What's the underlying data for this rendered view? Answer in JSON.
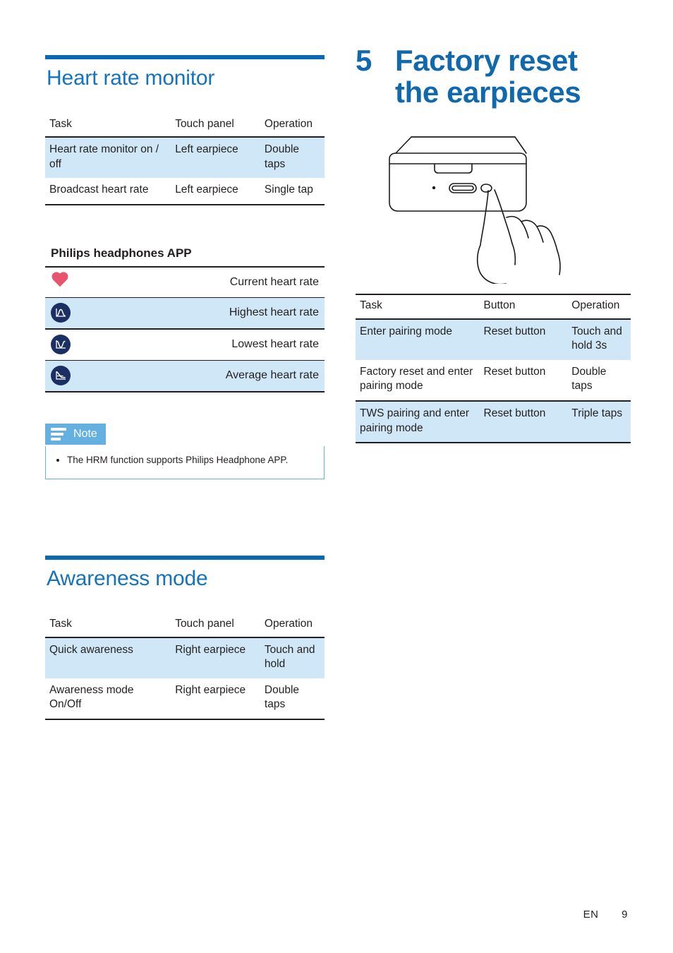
{
  "page": {
    "footer_lang": "EN",
    "footer_page": "9",
    "accent_blue": "#0b68b4",
    "heading_blue": "#1573bd",
    "chapter_blue": "#1068ad",
    "row_shade": "#cfe7f7",
    "heart_pink": "#e8546e",
    "navy": "#1c2f63",
    "note_blue": "#64b0e0"
  },
  "left": {
    "section1": {
      "title": "Heart rate monitor",
      "table": {
        "headers": [
          "Task",
          "Touch panel",
          "Operation"
        ],
        "rows": [
          [
            "Heart rate monitor on / off",
            "Left earpiece",
            "Double taps"
          ],
          [
            "Broadcast heart rate",
            "Left earpiece",
            "Single tap"
          ]
        ]
      },
      "subhead": "Philips headphones APP",
      "icon_rows": [
        {
          "icon": "heart-icon",
          "label": "Current heart rate"
        },
        {
          "icon": "peak-curve-icon",
          "label": "Highest heart rate"
        },
        {
          "icon": "valley-curve-icon",
          "label": "Lowest heart rate"
        },
        {
          "icon": "average-curve-icon",
          "label": "Average heart rate"
        }
      ],
      "note": {
        "label": "Note",
        "items": [
          "The HRM function supports Philips Headphone APP."
        ]
      }
    },
    "section2": {
      "title": "Awareness mode",
      "table": {
        "headers": [
          "Task",
          "Touch panel",
          "Operation"
        ],
        "rows": [
          [
            "Quick awareness",
            "Right earpiece",
            "Touch and hold"
          ],
          [
            "Awareness mode On/Off",
            "Right earpiece",
            "Double taps"
          ]
        ]
      }
    }
  },
  "right": {
    "chapter": {
      "number": "5",
      "title_line1": "Factory reset",
      "title_line2": "the earpieces"
    },
    "illustration": {
      "name": "charging-case-reset-button-finger-press",
      "parts": [
        "charging-case",
        "led-indicator",
        "usb-c-port",
        "reset-button",
        "hand-index-finger"
      ]
    },
    "table": {
      "headers": [
        "Task",
        "Button",
        "Operation"
      ],
      "rows": [
        [
          "Enter pairing mode",
          "Reset button",
          "Touch and hold 3s"
        ],
        [
          "Factory reset and enter pairing mode",
          "Reset button",
          "Double taps"
        ],
        [
          "TWS pairing and enter pairing mode",
          "Reset button",
          "Triple taps"
        ]
      ]
    }
  }
}
